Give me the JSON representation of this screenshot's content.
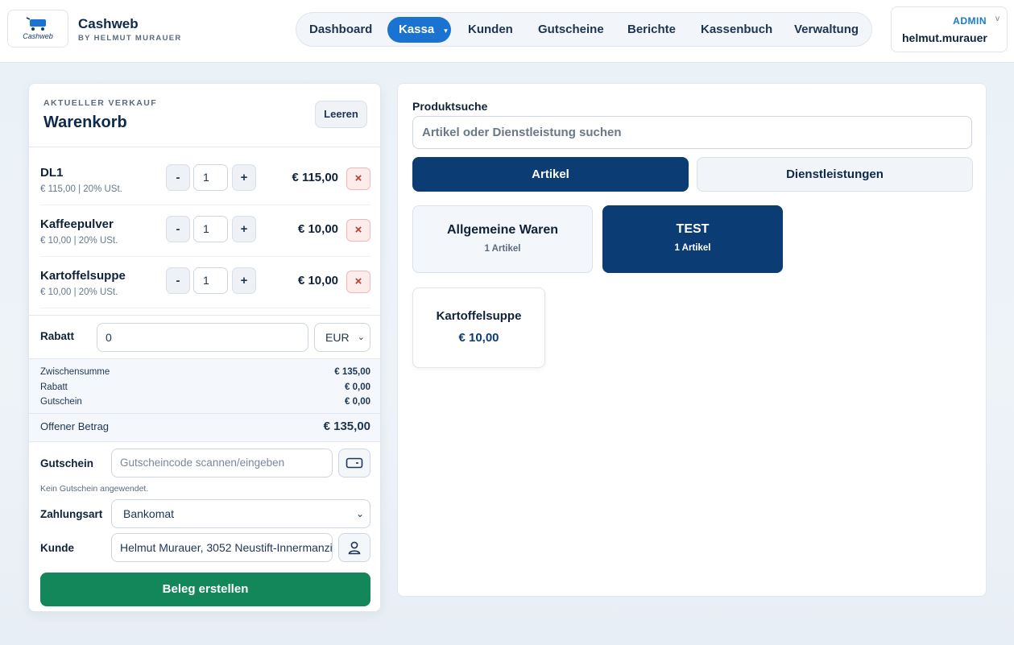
{
  "app": {
    "logo_text": "Cashweb",
    "title": "Cashweb",
    "subtitle": "BY HELMUT MURAUER"
  },
  "nav": {
    "items": [
      {
        "label": "Dashboard"
      },
      {
        "label": "Kassa",
        "active": true
      },
      {
        "label": "Kunden"
      },
      {
        "label": "Gutscheine"
      },
      {
        "label": "Berichte"
      },
      {
        "label": "Kassenbuch"
      },
      {
        "label": "Verwaltung"
      }
    ],
    "active_chevron": "▾"
  },
  "user": {
    "role": "ADMIN",
    "name": "helmut.murauer",
    "chevron": "v"
  },
  "cart": {
    "kicker": "AKTUELLER VERKAUF",
    "title": "Warenkorb",
    "clear_label": "Leeren",
    "minus": "-",
    "plus": "+",
    "remove": "×",
    "items": [
      {
        "name": "DL1",
        "sub": "€ 115,00 | 20% USt.",
        "qty": "1",
        "price": "€ 115,00"
      },
      {
        "name": "Kaffeepulver",
        "sub": "€ 10,00 | 20% USt.",
        "qty": "1",
        "price": "€ 10,00"
      },
      {
        "name": "Kartoffelsuppe",
        "sub": "€ 10,00 | 20% USt.",
        "qty": "1",
        "price": "€ 10,00"
      }
    ],
    "discount": {
      "label": "Rabatt",
      "value": "0",
      "unit": "EUR"
    },
    "totals": {
      "subtotal_label": "Zwischensumme",
      "subtotal": "€ 135,00",
      "discount_label": "Rabatt",
      "discount": "€ 0,00",
      "voucher_label": "Gutschein",
      "voucher": "€ 0,00",
      "open_label": "Offener Betrag",
      "open": "€ 135,00"
    },
    "voucher": {
      "label": "Gutschein",
      "placeholder": "Gutscheincode scannen/eingeben",
      "hint": "Kein Gutschein angewendet."
    },
    "payment": {
      "label": "Zahlungsart",
      "value": "Bankomat"
    },
    "customer": {
      "label": "Kunde",
      "value": "Helmut Murauer, 3052 Neustift-Innermanzing"
    },
    "submit_label": "Beleg erstellen"
  },
  "products": {
    "search_label": "Produktsuche",
    "search_placeholder": "Artikel oder Dienstleistung suchen",
    "tabs": [
      {
        "label": "Artikel",
        "active": true
      },
      {
        "label": "Dienstleistungen",
        "active": false
      }
    ],
    "categories": [
      {
        "name": "Allgemeine Waren",
        "count": "1 Artikel",
        "active": false
      },
      {
        "name": "TEST",
        "count": "1 Artikel",
        "active": true
      }
    ],
    "items": [
      {
        "name": "Kartoffelsuppe",
        "price": "€ 10,00"
      }
    ]
  },
  "colors": {
    "primary": "#0b3c73",
    "accent": "#1a73d1",
    "success": "#14875a",
    "danger": "#c0392b"
  }
}
